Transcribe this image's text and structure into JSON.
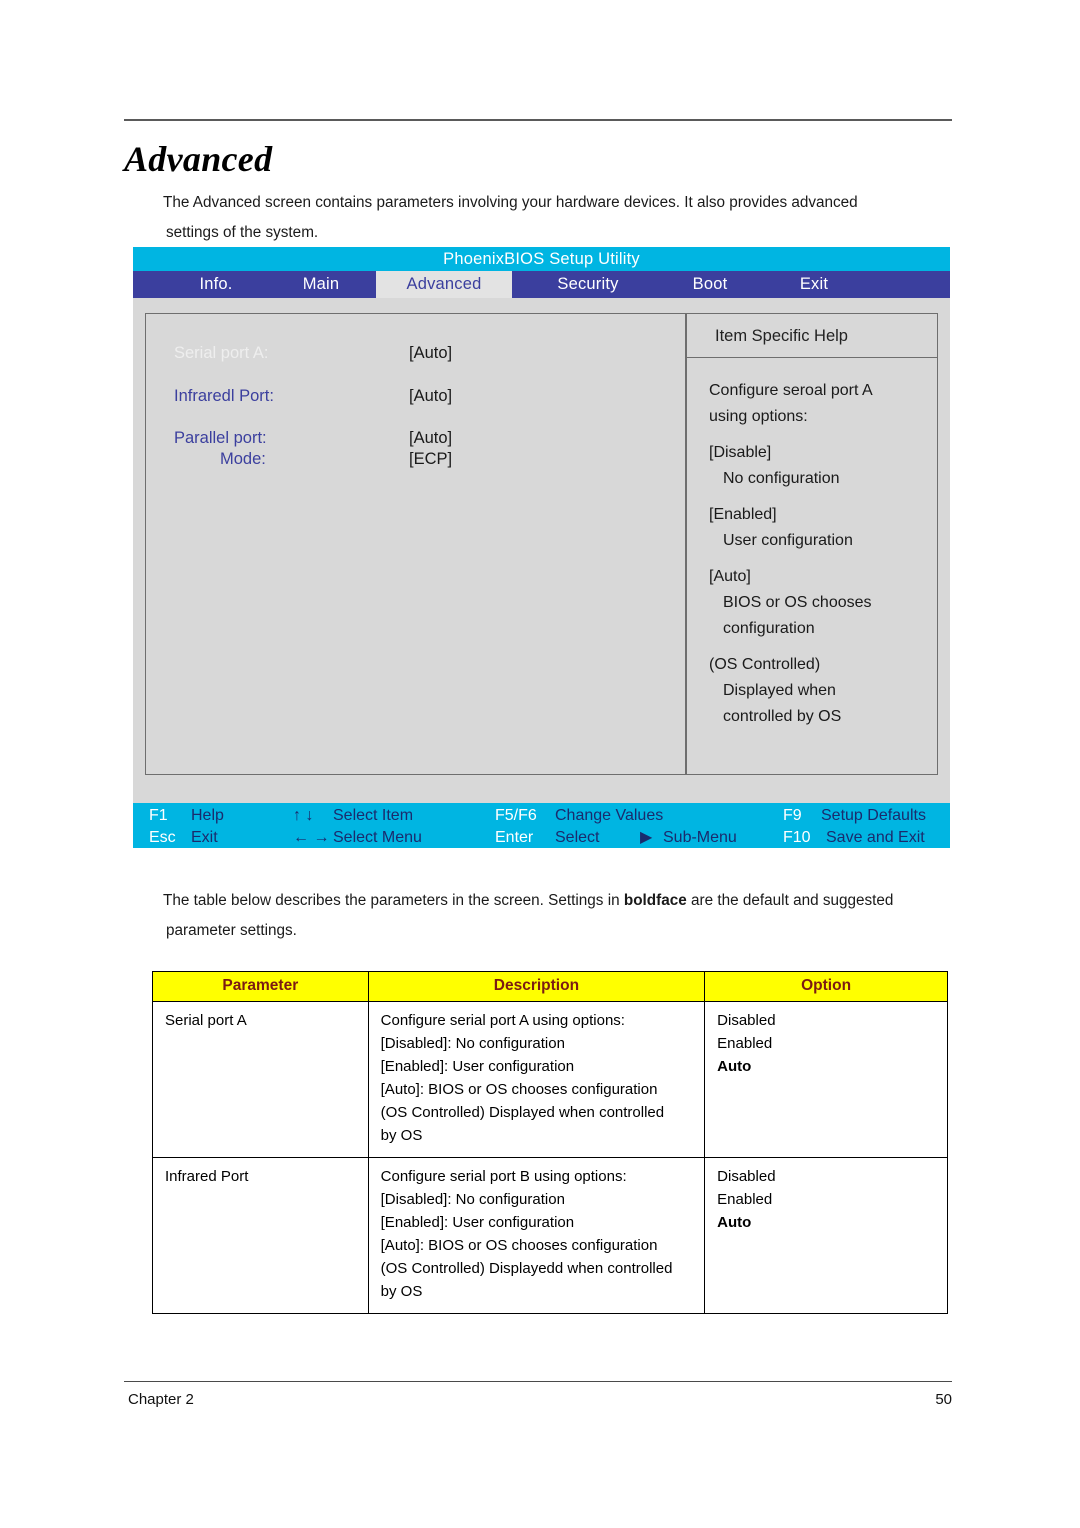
{
  "document": {
    "heading": "Advanced",
    "intro_line1": "The Advanced screen contains parameters involving your hardware devices. It also provides advanced",
    "intro_line2": "settings of the system.",
    "mid_line1_a": "The table below describes the parameters in the screen. Settings in ",
    "mid_line1_bold": "boldface",
    "mid_line1_b": " are the default and suggested",
    "mid_line2": "parameter settings."
  },
  "bios": {
    "title": "PhoenixBIOS Setup Utility",
    "tabs": [
      {
        "label": "Info.",
        "active": false
      },
      {
        "label": "Main",
        "active": false
      },
      {
        "label": "Advanced",
        "active": true
      },
      {
        "label": "Security",
        "active": false
      },
      {
        "label": "Boot",
        "active": false
      },
      {
        "label": "Exit",
        "active": false
      }
    ],
    "settings": [
      {
        "label": "Serial port A:",
        "value": "[Auto]",
        "selected": true
      },
      {
        "label": "Infraredl Port:",
        "value": "[Auto]",
        "selected": false
      },
      {
        "label": "Parallel port:",
        "value": "[Auto]",
        "selected": false
      },
      {
        "label": "Mode:",
        "value": "[ECP]",
        "selected": false
      }
    ],
    "help": {
      "title": "Item Specific Help",
      "intro_line1": "Configure seroal port A",
      "intro_line2": "using options:",
      "items": [
        {
          "key": "[Disable]",
          "desc": "No configuration"
        },
        {
          "key": "[Enabled]",
          "desc": "User configuration"
        },
        {
          "key": "[Auto]",
          "desc_line1": "BIOS or OS chooses",
          "desc_line2": "configuration"
        },
        {
          "key": "(OS Controlled)",
          "desc_line1": "Displayed when",
          "desc_line2": "controlled by OS"
        }
      ]
    },
    "keys": {
      "f1_key": "F1",
      "f1_desc": "Help",
      "updown_key": "↑ ↓",
      "updown_desc": "Select Item",
      "f5f6_key": "F5/F6",
      "f5f6_desc": "Change Values",
      "f9_key": "F9",
      "f9_desc": "Setup Defaults",
      "esc_key": "Esc",
      "esc_desc": "Exit",
      "leftright_key": "← →",
      "leftright_desc": "Select Menu",
      "enter_key": "Enter",
      "enter_desc": "Select",
      "enter_arrow": "▶",
      "enter_submenu": "Sub-Menu",
      "f10_key": "F10",
      "f10_desc": "Save and Exit"
    },
    "colors": {
      "title_bar": "#00b5e2",
      "tab_bar": "#3b3f9e",
      "active_tab_bg": "#e3e3e3",
      "panel_bg": "#d8d8d8",
      "key_bar": "#00b5e2",
      "label_blue": "#3b3f9e"
    }
  },
  "table": {
    "headers": [
      "Parameter",
      "Description",
      "Option"
    ],
    "header_bg": "#ffff00",
    "header_color": "#7b1b13",
    "rows": [
      {
        "parameter": "Serial port A",
        "description": [
          "Configure serial port A using options:",
          "[Disabled]: No configuration",
          "[Enabled]: User configuration",
          "[Auto]: BIOS or OS chooses configuration",
          "(OS Controlled) Displayed when controlled",
          "by OS"
        ],
        "options": [
          {
            "label": "Disabled",
            "bold": false
          },
          {
            "label": "Enabled",
            "bold": false
          },
          {
            "label": "Auto",
            "bold": true
          }
        ]
      },
      {
        "parameter": "Infrared Port",
        "description": [
          "Configure serial port B using options:",
          "[Disabled]: No configuration",
          "[Enabled]: User configuration",
          "[Auto]: BIOS or OS chooses configuration",
          "(OS Controlled) Displayedd when controlled",
          "by OS"
        ],
        "options": [
          {
            "label": "Disabled",
            "bold": false
          },
          {
            "label": "Enabled",
            "bold": false
          },
          {
            "label": "Auto",
            "bold": true
          }
        ]
      }
    ]
  },
  "footer": {
    "chapter": "Chapter 2",
    "page_number": "50"
  }
}
